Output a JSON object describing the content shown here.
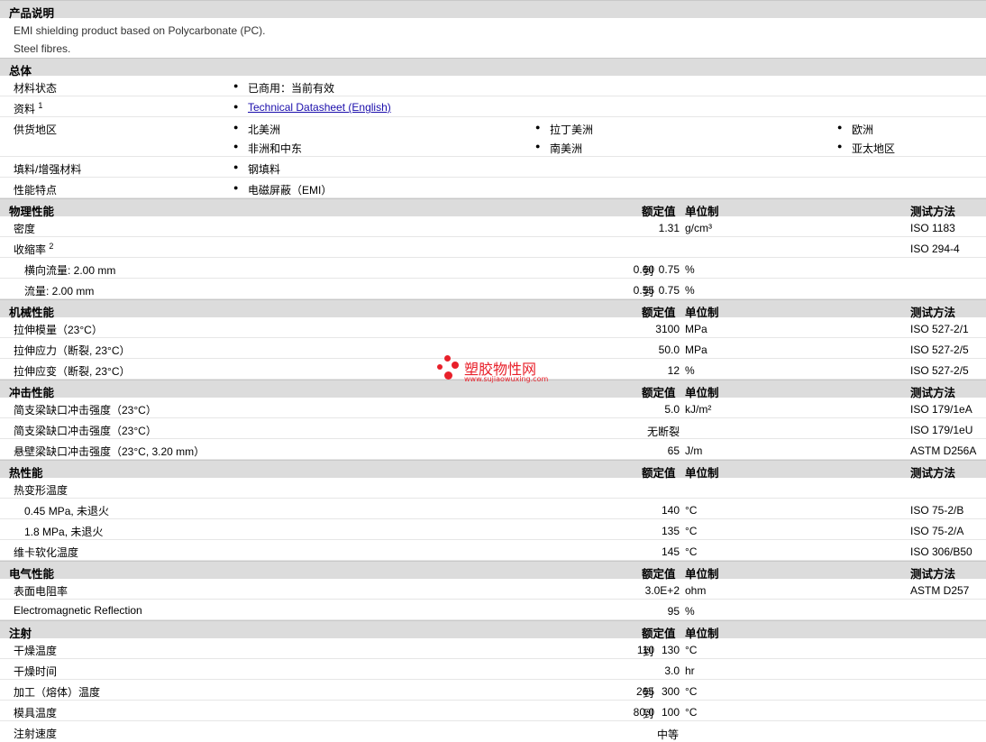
{
  "product": {
    "title": "产品说明",
    "desc1": "EMI shielding product based on Polycarbonate (PC).",
    "desc2": "Steel fibres."
  },
  "general": {
    "title": "总体",
    "status_label": "材料状态",
    "status_value": "已商用：当前有效",
    "docs_label": "资料",
    "docs_sup": "1",
    "docs_link": "Technical Datasheet (English)",
    "region_label": "供货地区",
    "regions": [
      "北美洲",
      "拉丁美洲",
      "欧洲",
      "非洲和中东",
      "南美洲",
      "亚太地区"
    ],
    "filler_label": "填料/增强材料",
    "filler_value": "钢填料",
    "feature_label": "性能特点",
    "feature_value": "电磁屏蔽（EMI）"
  },
  "headers": {
    "nominal": "额定值",
    "unit": "单位制",
    "method": "测试方法"
  },
  "physical": {
    "title": "物理性能",
    "density_label": "密度",
    "density_value": "1.31",
    "density_unit": "g/cm³",
    "density_method": "ISO 1183",
    "shrink_label": "收缩率",
    "shrink_sup": "2",
    "shrink_method": "ISO 294-4",
    "shrink1_label": "横向流量: 2.00 mm",
    "shrink1_from": "0.60",
    "shrink1_to": "到",
    "shrink1_value": "0.75",
    "shrink1_unit": "%",
    "shrink2_label": "流量: 2.00 mm",
    "shrink2_from": "0.55",
    "shrink2_to": "到",
    "shrink2_value": "0.75",
    "shrink2_unit": "%"
  },
  "mechanical": {
    "title": "机械性能",
    "r1_label": "拉伸模量（23°C）",
    "r1_value": "3100",
    "r1_unit": "MPa",
    "r1_method": "ISO 527-2/1",
    "r2_label": "拉伸应力（断裂, 23°C）",
    "r2_value": "50.0",
    "r2_unit": "MPa",
    "r2_method": "ISO 527-2/5",
    "r3_label": "拉伸应变（断裂, 23°C）",
    "r3_value": "12",
    "r3_unit": "%",
    "r3_method": "ISO 527-2/5"
  },
  "impact": {
    "title": "冲击性能",
    "r1_label": "简支梁缺口冲击强度（23°C）",
    "r1_value": "5.0",
    "r1_unit": "kJ/m²",
    "r1_method": "ISO 179/1eA",
    "r2_label": "简支梁缺口冲击强度（23°C）",
    "r2_value": "无断裂",
    "r2_method": "ISO 179/1eU",
    "r3_label": "悬壁梁缺口冲击强度（23°C, 3.20 mm）",
    "r3_value": "65",
    "r3_unit": "J/m",
    "r3_method": "ASTM D256A"
  },
  "thermal": {
    "title": "热性能",
    "hdt_label": "热变形温度",
    "r1_label": "0.45 MPa, 未退火",
    "r1_value": "140",
    "r1_unit": "°C",
    "r1_method": "ISO 75-2/B",
    "r2_label": "1.8 MPa, 未退火",
    "r2_value": "135",
    "r2_unit": "°C",
    "r2_method": "ISO 75-2/A",
    "r3_label": "维卡软化温度",
    "r3_value": "145",
    "r3_unit": "°C",
    "r3_method": "ISO 306/B50"
  },
  "electrical": {
    "title": "电气性能",
    "r1_label": "表面电阻率",
    "r1_value": "3.0E+2",
    "r1_unit": "ohm",
    "r1_method": "ASTM D257",
    "r2_label": "Electromagnetic Reflection",
    "r2_value": "95",
    "r2_unit": "%"
  },
  "injection": {
    "title": "注射",
    "r1_label": "干燥温度",
    "r1_from": "110",
    "r1_to": "到",
    "r1_value": "130",
    "r1_unit": "°C",
    "r2_label": "干燥时间",
    "r2_value": "3.0",
    "r2_unit": "hr",
    "r3_label": "加工（熔体）温度",
    "r3_from": "265",
    "r3_to": "到",
    "r3_value": "300",
    "r3_unit": "°C",
    "r4_label": "模具温度",
    "r4_from": "80.0",
    "r4_to": "到",
    "r4_value": "100",
    "r4_unit": "°C",
    "r5_label": "注射速度",
    "r5_value": "中等"
  },
  "watermark": {
    "name": "塑胶物性网",
    "url": "www.sujiaowuxing.com",
    "color": "#e8202a"
  }
}
